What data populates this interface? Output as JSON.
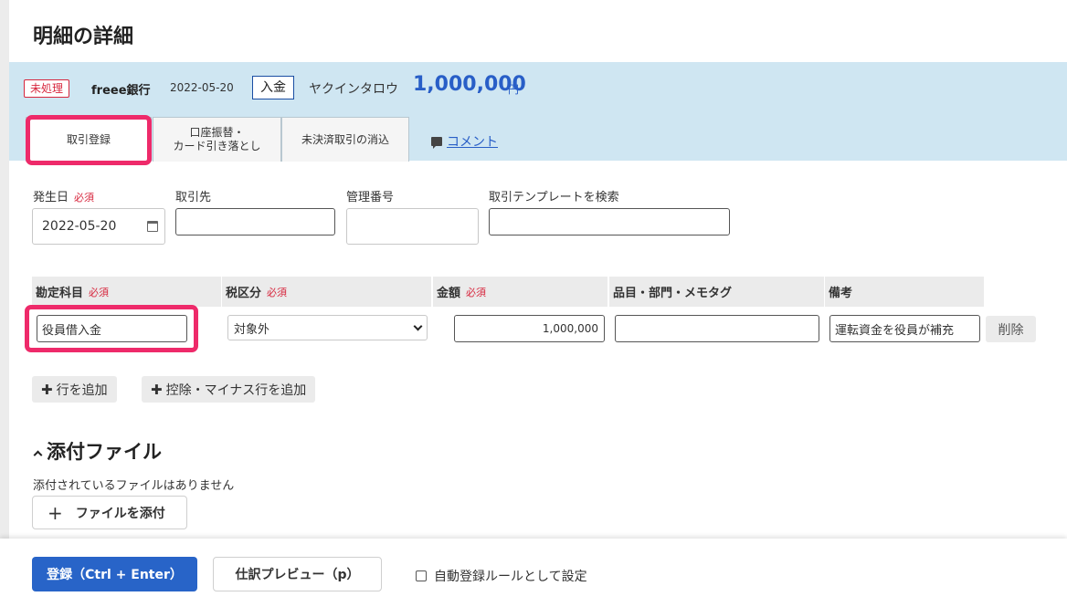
{
  "page_title": "明細の詳細",
  "header": {
    "status_badge": "未処理",
    "bank": "freee銀行",
    "date": "2022-05-20",
    "kind": "入金",
    "partner": "ヤクインタロウ",
    "amount": "1,000,000",
    "currency": "円"
  },
  "tabs": {
    "register": "取引登録",
    "transfer_line1": "口座振替・",
    "transfer_line2": "カード引き落とし",
    "clearing": "未決済取引の消込",
    "comment": "コメント"
  },
  "form": {
    "date_label": "発生日",
    "required": "必須",
    "date_value": "2022-05-20",
    "partner_label": "取引先",
    "partner_value": "",
    "mgmt_label": "管理番号",
    "mgmt_value": "",
    "template_label": "取引テンプレートを検索",
    "template_value": ""
  },
  "table": {
    "headers": {
      "account": "勘定科目",
      "tax": "税区分",
      "amount": "金額",
      "tags": "品目・部門・メモタグ",
      "note": "備考"
    },
    "row": {
      "account": "役員借入金",
      "tax": "対象外",
      "amount": "1,000,000",
      "tags": "",
      "note": "運転資金を役員が補充",
      "delete": "削除"
    }
  },
  "buttons": {
    "add_row": "行を追加",
    "add_minus_row": "控除・マイナス行を追加"
  },
  "attachments": {
    "title": "添付ファイル",
    "empty": "添付されているファイルはありません",
    "add": "ファイルを添付"
  },
  "footer": {
    "submit": "登録（Ctrl + Enter）",
    "preview": "仕訳プレビュー（p）",
    "auto_rule": "自動登録ルールとして設定"
  },
  "colors": {
    "accent": "#2864c8",
    "header_band": "#cfe6f2",
    "required": "#d7263d",
    "highlight": "#ee2a6a"
  }
}
